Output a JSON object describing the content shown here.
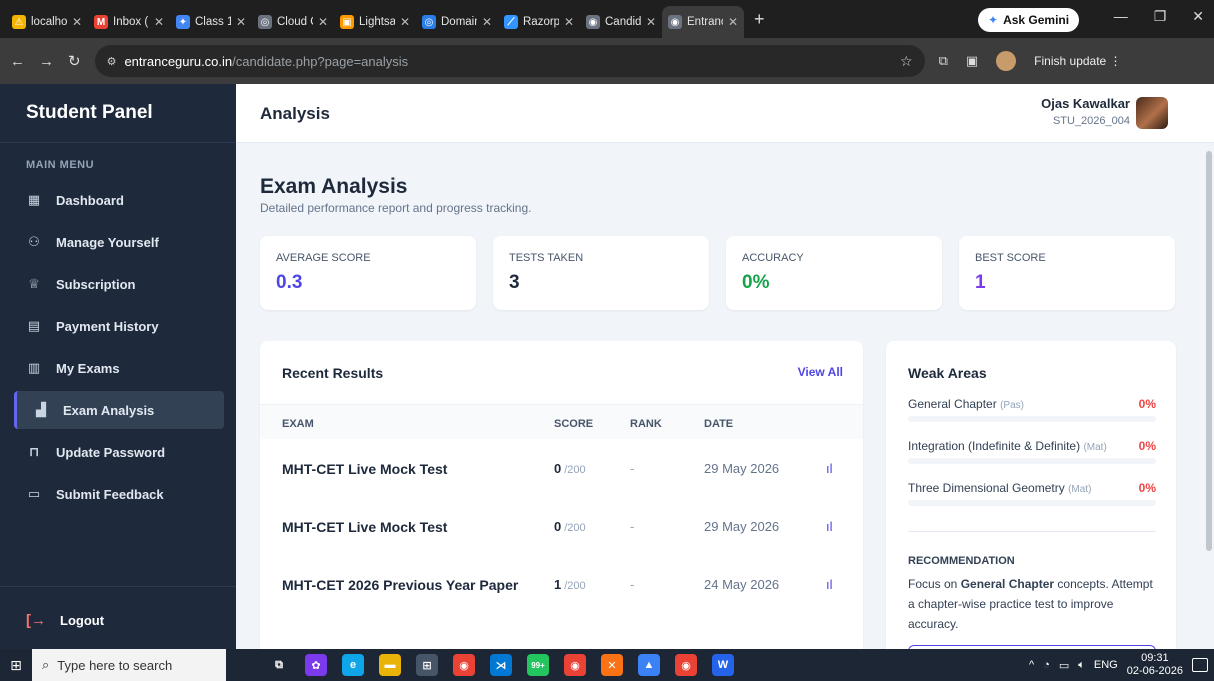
{
  "browser": {
    "tabs": [
      {
        "label": "localho",
        "color": "#f4b400",
        "glyph": "⚠"
      },
      {
        "label": "Inbox (",
        "color": "#ea4335",
        "glyph": "M"
      },
      {
        "label": "Class 1:",
        "color": "#4285f4",
        "glyph": "✦"
      },
      {
        "label": "Cloud C",
        "color": "#6b7280",
        "glyph": "◎"
      },
      {
        "label": "Lightsa",
        "color": "#ff9900",
        "glyph": "▣"
      },
      {
        "label": "Domain",
        "color": "#2b7de9",
        "glyph": "◎"
      },
      {
        "label": "Razorp",
        "color": "#3395ff",
        "glyph": "⟋"
      },
      {
        "label": "Candid",
        "color": "#6b7280",
        "glyph": "◉"
      },
      {
        "label": "Entranc",
        "color": "#6b7280",
        "glyph": "◉"
      }
    ],
    "ask_gemini": "Ask Gemini",
    "url_domain": "entranceguru.co.in",
    "url_path": "/candidate.php?page=analysis",
    "finish_update": "Finish update"
  },
  "sidebar": {
    "title": "Student Panel",
    "menu_heading": "MAIN MENU",
    "items": [
      {
        "label": "Dashboard",
        "icon": "grid-icon",
        "glyph": "▦",
        "active": false
      },
      {
        "label": "Manage Yourself",
        "icon": "user-icon",
        "glyph": "⚇",
        "active": false
      },
      {
        "label": "Subscription",
        "icon": "crown-icon",
        "glyph": "♕",
        "active": false
      },
      {
        "label": "Payment History",
        "icon": "receipt-icon",
        "glyph": "▤",
        "active": false
      },
      {
        "label": "My Exams",
        "icon": "clipboard-icon",
        "glyph": "▥",
        "active": false
      },
      {
        "label": "Exam Analysis",
        "icon": "bar-chart-icon",
        "glyph": "▟",
        "active": true
      },
      {
        "label": "Update Password",
        "icon": "lock-icon",
        "glyph": "⊓",
        "active": false
      },
      {
        "label": "Submit Feedback",
        "icon": "message-icon",
        "glyph": "▭",
        "active": false
      }
    ],
    "logout": "Logout"
  },
  "header": {
    "title": "Analysis",
    "user_name": "Ojas Kawalkar",
    "user_id": "STU_2026_004"
  },
  "main": {
    "title": "Exam Analysis",
    "subtitle": "Detailed performance report and progress tracking.",
    "stats": [
      {
        "label": "AVERAGE SCORE",
        "value": "0.3",
        "color": "#4f46e5"
      },
      {
        "label": "TESTS TAKEN",
        "value": "3",
        "color": "#1e293b"
      },
      {
        "label": "ACCURACY",
        "value": "0%",
        "color": "#16a34a"
      },
      {
        "label": "BEST SCORE",
        "value": "1",
        "color": "#7c3aed"
      }
    ]
  },
  "recent": {
    "title": "Recent Results",
    "view_all": "View All",
    "columns": {
      "exam": "EXAM",
      "score": "SCORE",
      "rank": "RANK",
      "date": "DATE"
    },
    "rows": [
      {
        "exam": "MHT-CET Live Mock Test",
        "score": "0",
        "out_of": "/200",
        "rank": "-",
        "date": "29 May 2026"
      },
      {
        "exam": "MHT-CET Live Mock Test",
        "score": "0",
        "out_of": "/200",
        "rank": "-",
        "date": "29 May 2026"
      },
      {
        "exam": "MHT-CET 2026 Previous Year Paper",
        "score": "1",
        "out_of": "/200",
        "rank": "-",
        "date": "24 May 2026"
      }
    ]
  },
  "weak": {
    "title": "Weak Areas",
    "items": [
      {
        "name": "General Chapter",
        "subject": "(Pas)",
        "pct": "0%",
        "level": 0
      },
      {
        "name": "Integration (Indefinite & Definite)",
        "subject": "(Mat)",
        "pct": "0%",
        "level": 0
      },
      {
        "name": "Three Dimensional Geometry",
        "subject": "(Mat)",
        "pct": "0%",
        "level": 0
      }
    ],
    "rec_heading": "RECOMMENDATION",
    "rec_prefix": "Focus on ",
    "rec_bold": "General Chapter",
    "rec_suffix": " concepts. Attempt a chapter-wise practice test to improve accuracy."
  },
  "taskbar": {
    "search_placeholder": "Type here to search",
    "apps": [
      {
        "icon": "task-view-icon",
        "color": "#1c2634",
        "glyph": "⧉"
      },
      {
        "icon": "copilot-icon",
        "color": "#7c3aed",
        "glyph": "✿"
      },
      {
        "icon": "edge-icon",
        "color": "#0ea5e9",
        "glyph": "e"
      },
      {
        "icon": "file-explorer-icon",
        "color": "#eab308",
        "glyph": "▬"
      },
      {
        "icon": "store-icon",
        "color": "#475569",
        "glyph": "⊞"
      },
      {
        "icon": "chrome-icon",
        "color": "#ea4335",
        "glyph": "◉"
      },
      {
        "icon": "vscode-icon",
        "color": "#0078d4",
        "glyph": "⋊"
      },
      {
        "icon": "whatsapp-icon",
        "color": "#22c55e",
        "glyph": "99+"
      },
      {
        "icon": "chrome-icon-2",
        "color": "#ea4335",
        "glyph": "◉"
      },
      {
        "icon": "xampp-icon",
        "color": "#f97316",
        "glyph": "✕"
      },
      {
        "icon": "app-icon",
        "color": "#3b82f6",
        "glyph": "▲"
      },
      {
        "icon": "chrome-icon-3",
        "color": "#ea4335",
        "glyph": "◉"
      },
      {
        "icon": "word-icon",
        "color": "#2563eb",
        "glyph": "W"
      }
    ],
    "lang": "ENG",
    "time": "09:31",
    "date": "02-06-2026"
  }
}
